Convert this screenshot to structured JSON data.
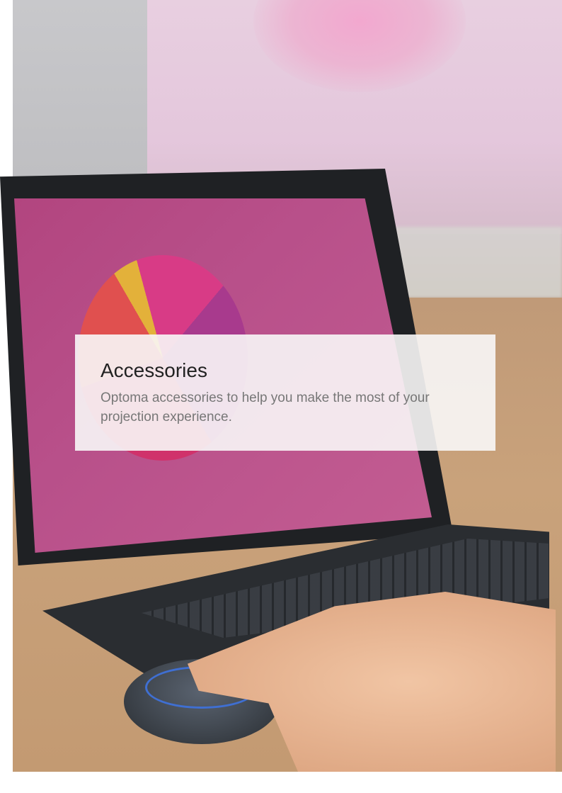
{
  "panel": {
    "title": "Accessories",
    "subtitle": "Optoma accessories to help you make the most of your projection experience."
  },
  "photo": {
    "subject": "laptop-with-wireless-presentation-button",
    "colors": {
      "screen": "#b8508a",
      "table": "#c39a72",
      "panel_background": "#f8f7f7",
      "title": "#222222",
      "subtitle": "#777777"
    }
  }
}
